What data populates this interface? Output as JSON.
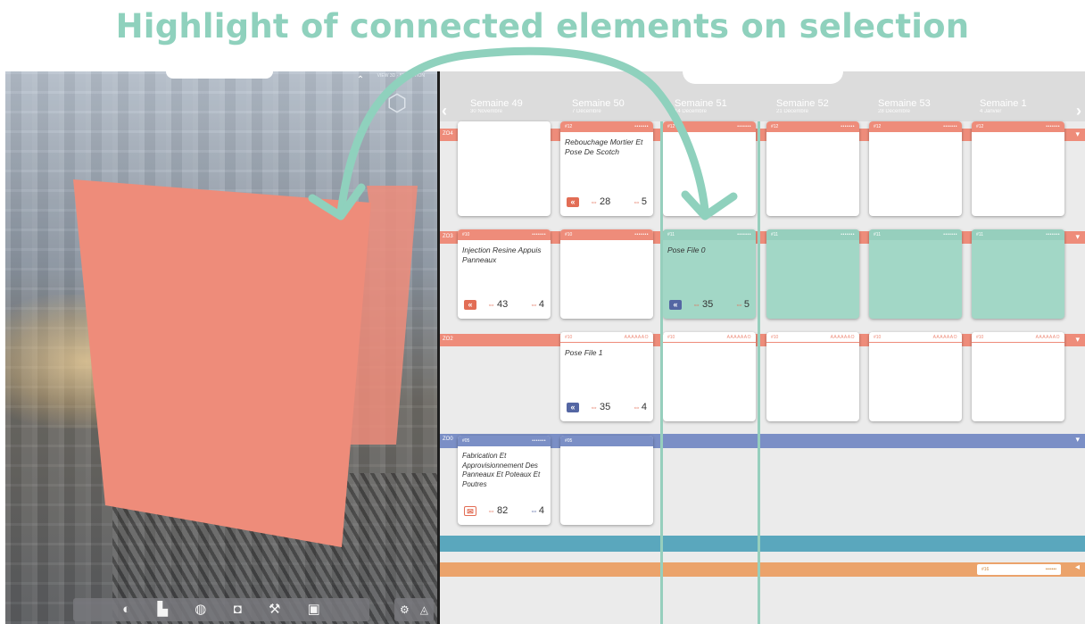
{
  "headline": "Highlight of connected elements on selection",
  "colors": {
    "headline": "#8fd1bd",
    "coral": "#ee8c7a",
    "teal": "#96cfbd",
    "blue": "#7b8fc6",
    "steel": "#5aa7bd",
    "orange": "#eba36b",
    "panel": "#ebebeb"
  },
  "viewport": {
    "corner_text": "VIEW 3D · SELECTION",
    "up_icon": "chevron-up-icon",
    "cube_icon": "view-cube-icon",
    "toolbar_icons": [
      "section-icon",
      "layers-icon",
      "phase-icon",
      "zone-icon",
      "worker-icon",
      "tools-icon"
    ],
    "toolbar_glyphs": [
      "◐",
      "▙",
      "◍",
      "◘",
      "⚒",
      "▣"
    ],
    "toolbar2_glyphs": [
      "⚙",
      "◬"
    ]
  },
  "planning": {
    "weeks": [
      {
        "title": "Semaine 49",
        "sub": "30 Novembre"
      },
      {
        "title": "Semaine 50",
        "sub": "7 Décembre"
      },
      {
        "title": "Semaine 51",
        "sub": "14 Décembre"
      },
      {
        "title": "Semaine 52",
        "sub": "21 Décembre"
      },
      {
        "title": "Semaine 53",
        "sub": "28 Décembre"
      },
      {
        "title": "Semaine 1",
        "sub": "4 Janvier"
      }
    ],
    "nav_left": "‹",
    "nav_right": "›",
    "row_labels": [
      "ZO4",
      "ZO3",
      "ZO2",
      "ZO0"
    ],
    "caret": "▾",
    "orange_caret": "◂",
    "cards": {
      "c1": {
        "id": "#12",
        "dots": "•••••••",
        "title": "Rebouchage Mortier Et Pose De Scotch",
        "n1": "28",
        "n2": "5"
      },
      "c2": {
        "id": "#10",
        "dots": "•••••••",
        "title": "Injection Resine Appuis Panneaux",
        "n1": "43",
        "n2": "4"
      },
      "c3": {
        "id": "#11",
        "dots": "•••••••",
        "title": "Pose File 0",
        "n1": "35",
        "n2": "5"
      },
      "c4": {
        "id": "#10",
        "dots": "AAAAAAO",
        "title": "Pose File 1",
        "n1": "35",
        "n2": "4"
      },
      "c5": {
        "id": "#05",
        "dots": "•••••••",
        "title": "Fabrication Et Approvisionnement Des Panneaux Et Poteaux Et Poutres",
        "n1": "82",
        "n2": "4"
      }
    },
    "placeholder_id": "#12",
    "placeholder_dots": "•••••••",
    "placeholder_id_b": "#10",
    "placeholder_dots_b": "AAAAAAO",
    "placeholder_id_c": "#05",
    "mini_id": "#16",
    "mini_dots": "•••••••",
    "btn_glyph": "«",
    "n1_sym": "⇔",
    "n2_sym": "⇔"
  }
}
